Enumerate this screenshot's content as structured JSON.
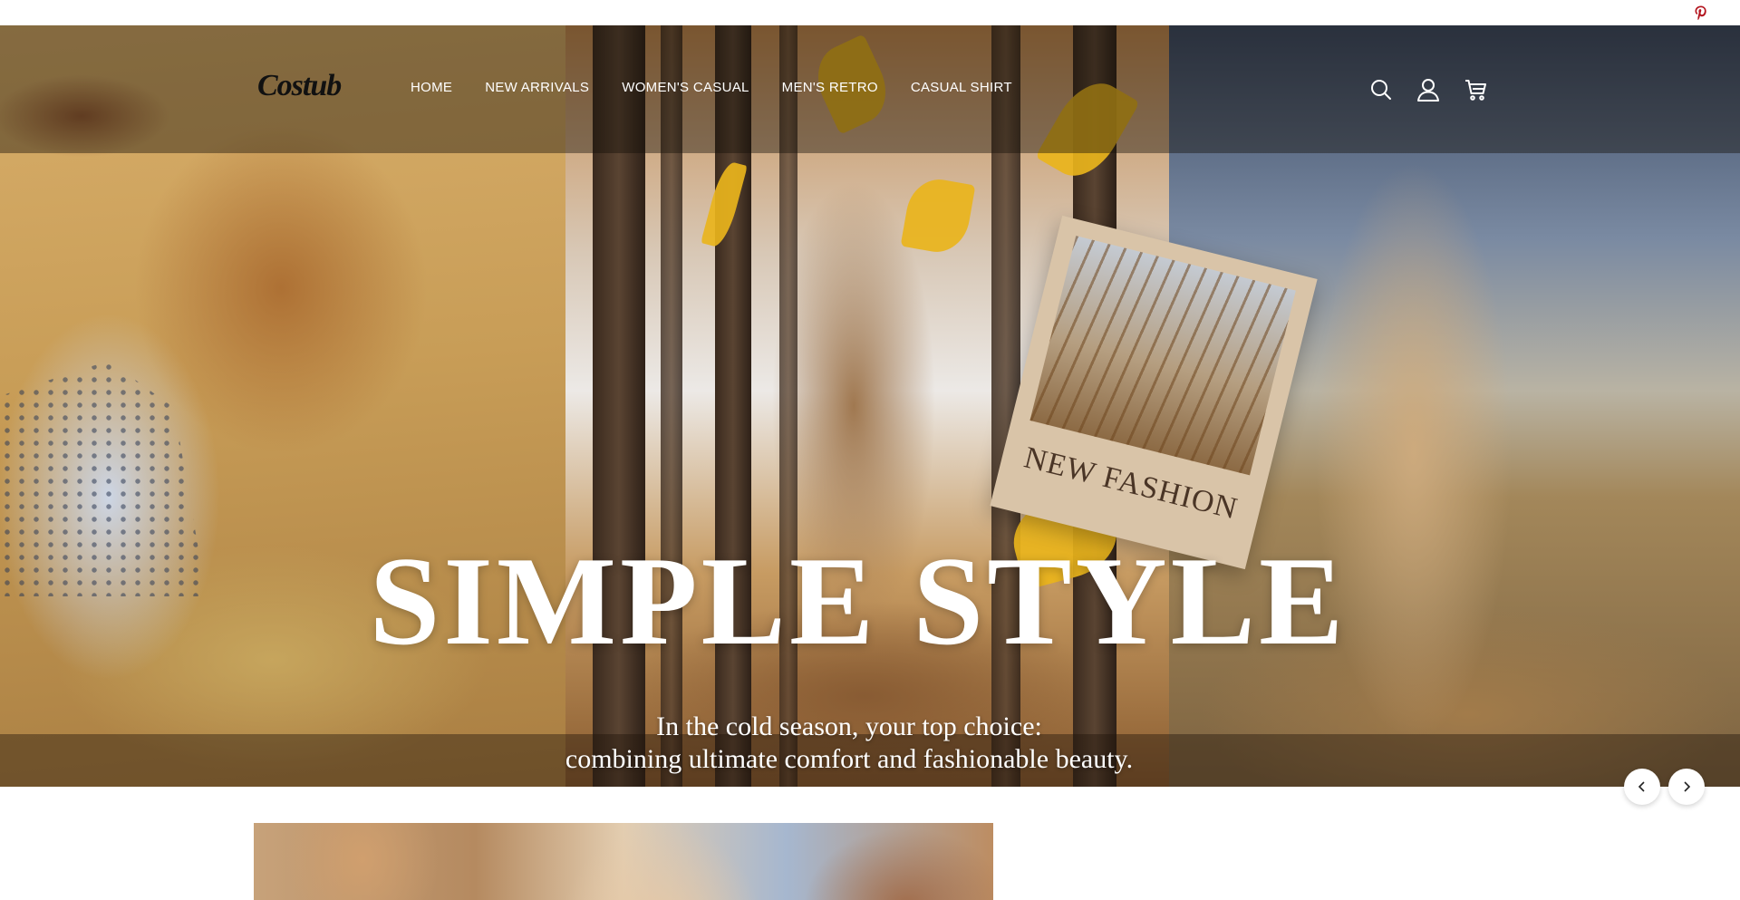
{
  "topbar": {
    "social_icon": "pinterest-icon"
  },
  "header": {
    "logo_text": "Costub",
    "nav": [
      {
        "label": "HOME"
      },
      {
        "label": "NEW ARRIVALS"
      },
      {
        "label": "WOMEN'S CASUAL"
      },
      {
        "label": "MEN'S RETRO"
      },
      {
        "label": "CASUAL SHIRT"
      }
    ],
    "icons": [
      "search-icon",
      "account-icon",
      "cart-icon"
    ]
  },
  "hero": {
    "card_caption": "NEW FASHION",
    "title": "SIMPLE STYLE",
    "subtitle_line1": "In the cold season, your top choice:",
    "subtitle_line2": "combining ultimate comfort and fashionable beauty.",
    "controls": {
      "prev_icon": "chevron-left-icon",
      "next_icon": "chevron-right-icon"
    }
  },
  "colors": {
    "header_text": "#ffffff",
    "logo": "#111111",
    "hero_text": "#ffffff",
    "card_caption": "#4a3526",
    "leaf": "#e9b41c"
  }
}
